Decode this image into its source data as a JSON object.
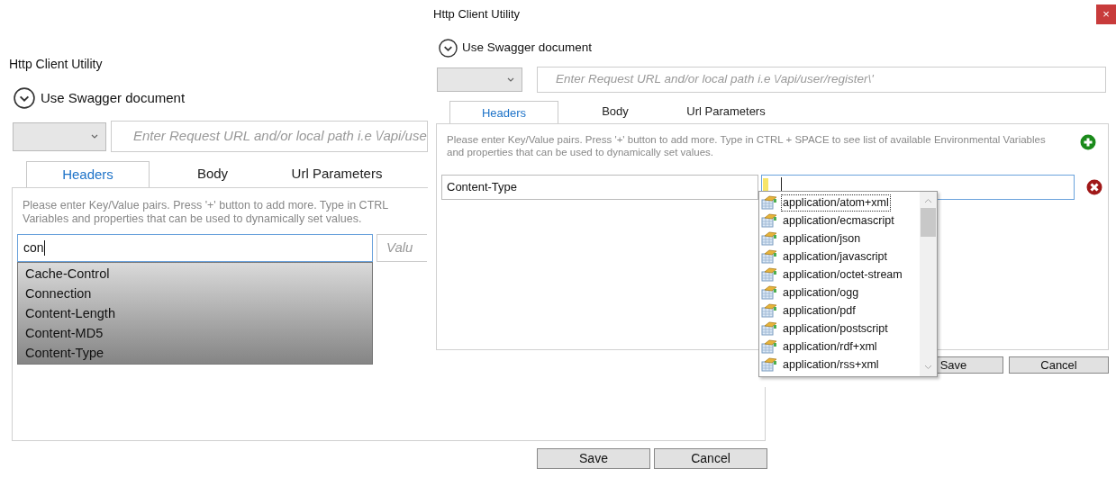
{
  "background_window": {
    "title": "Http Client Utility",
    "swagger_label": "Use Swagger document",
    "url_field": {
      "placeholder": "Enter Request URL and/or local path i.e \\/api/use"
    },
    "tabs": [
      {
        "label": "Headers",
        "selected": true
      },
      {
        "label": "Body",
        "selected": false
      },
      {
        "label": "Url Parameters",
        "selected": false
      }
    ],
    "helper_text": "Please enter Key/Value pairs. Press '+' button to add more. Type in CTRL",
    "helper_text_2": "Variables and properties that can be used to dynamically set values.",
    "header_row": {
      "key": "con",
      "key_focused": true,
      "value_placeholder": "Valu",
      "value_focused": false
    },
    "suggestions": [
      "Cache-Control",
      "Connection",
      "Content-Length",
      "Content-MD5",
      "Content-Type"
    ],
    "buttons": [
      "Save",
      "Cancel"
    ]
  },
  "foreground_window": {
    "title": "Http Client Utility",
    "close_button": "×",
    "swagger_label": "Use Swagger document",
    "url_field": {
      "placeholder": "Enter Request URL and/or local path i.e \\/api/user/register\\'"
    },
    "tabs": [
      {
        "label": "Headers",
        "selected": true
      },
      {
        "label": "Body",
        "selected": false
      },
      {
        "label": "Url Parameters",
        "selected": false
      }
    ],
    "helper_text": "Please enter Key/Value pairs. Press '+' button to add more. Type in CTRL + SPACE to see list of available Environmental Variables and properties that can be used to dynamically set values.",
    "header_row": {
      "key": "Content-Type",
      "key_focused": false,
      "value_focused": true
    },
    "suggestions": [
      {
        "label": "application/atom+xml",
        "selected": true
      },
      {
        "label": "application/ecmascript",
        "selected": false
      },
      {
        "label": "application/json",
        "selected": false
      },
      {
        "label": "application/javascript",
        "selected": false
      },
      {
        "label": "application/octet-stream",
        "selected": false
      },
      {
        "label": "application/ogg",
        "selected": false
      },
      {
        "label": "application/pdf",
        "selected": false
      },
      {
        "label": "application/postscript",
        "selected": false
      },
      {
        "label": "application/rdf+xml",
        "selected": false
      },
      {
        "label": "application/rss+xml",
        "selected": false
      }
    ],
    "buttons": [
      "Save",
      "Cancel"
    ]
  }
}
